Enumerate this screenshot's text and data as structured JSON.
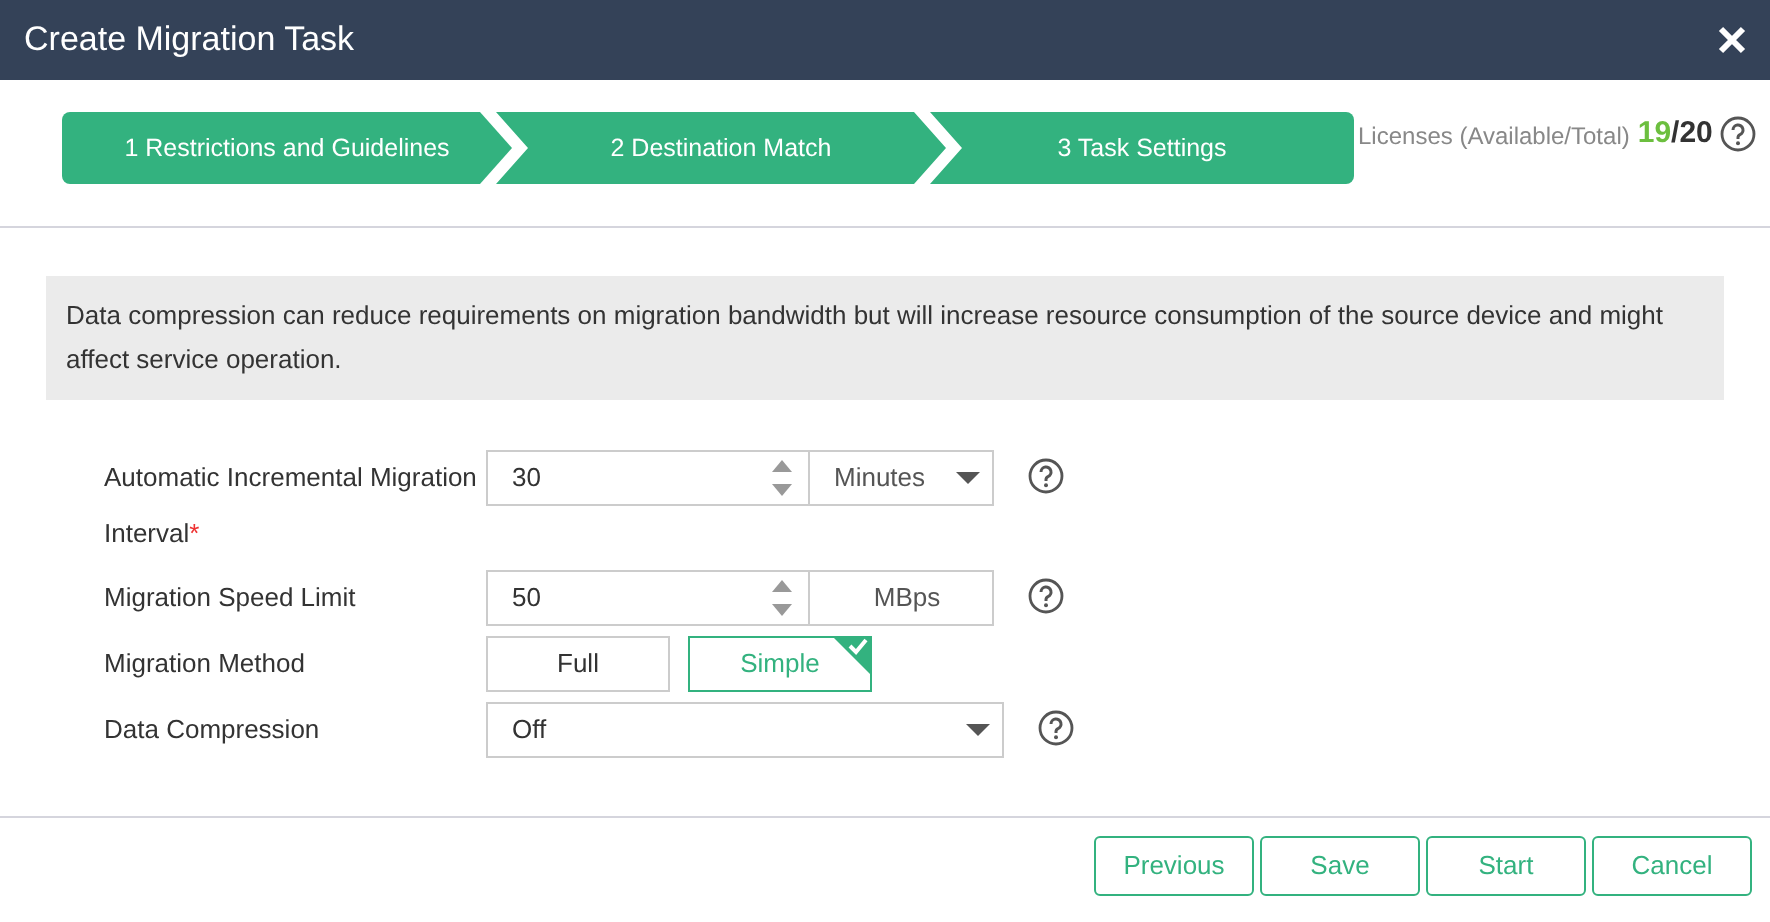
{
  "window": {
    "title": "Create Migration Task"
  },
  "steps": [
    {
      "label": "1 Restrictions and Guidelines"
    },
    {
      "label": "2 Destination Match"
    },
    {
      "label": "3 Task Settings"
    }
  ],
  "licenses": {
    "label": "Licenses (Available/Total)",
    "available": "19",
    "separator": "/",
    "total": "20"
  },
  "notice": "Data compression can reduce requirements on migration bandwidth but will increase resource consumption of the source device and might affect service operation.",
  "fields": [
    {
      "kind": "number-unit-select",
      "label": "Automatic Incremental Migration Interval",
      "required_mark": "*",
      "value": "30",
      "unit": "Minutes",
      "help": true
    },
    {
      "kind": "number-unit",
      "label": "Migration Speed Limit",
      "value": "50",
      "unit": "MBps",
      "help": true
    },
    {
      "kind": "choice",
      "label": "Migration Method",
      "options": [
        {
          "label": "Full",
          "selected": false
        },
        {
          "label": "Simple",
          "selected": true
        }
      ],
      "help": false
    },
    {
      "kind": "select",
      "label": "Data Compression",
      "value": "Off",
      "help": true
    }
  ],
  "buttons": [
    "Previous",
    "Save",
    "Start",
    "Cancel"
  ]
}
